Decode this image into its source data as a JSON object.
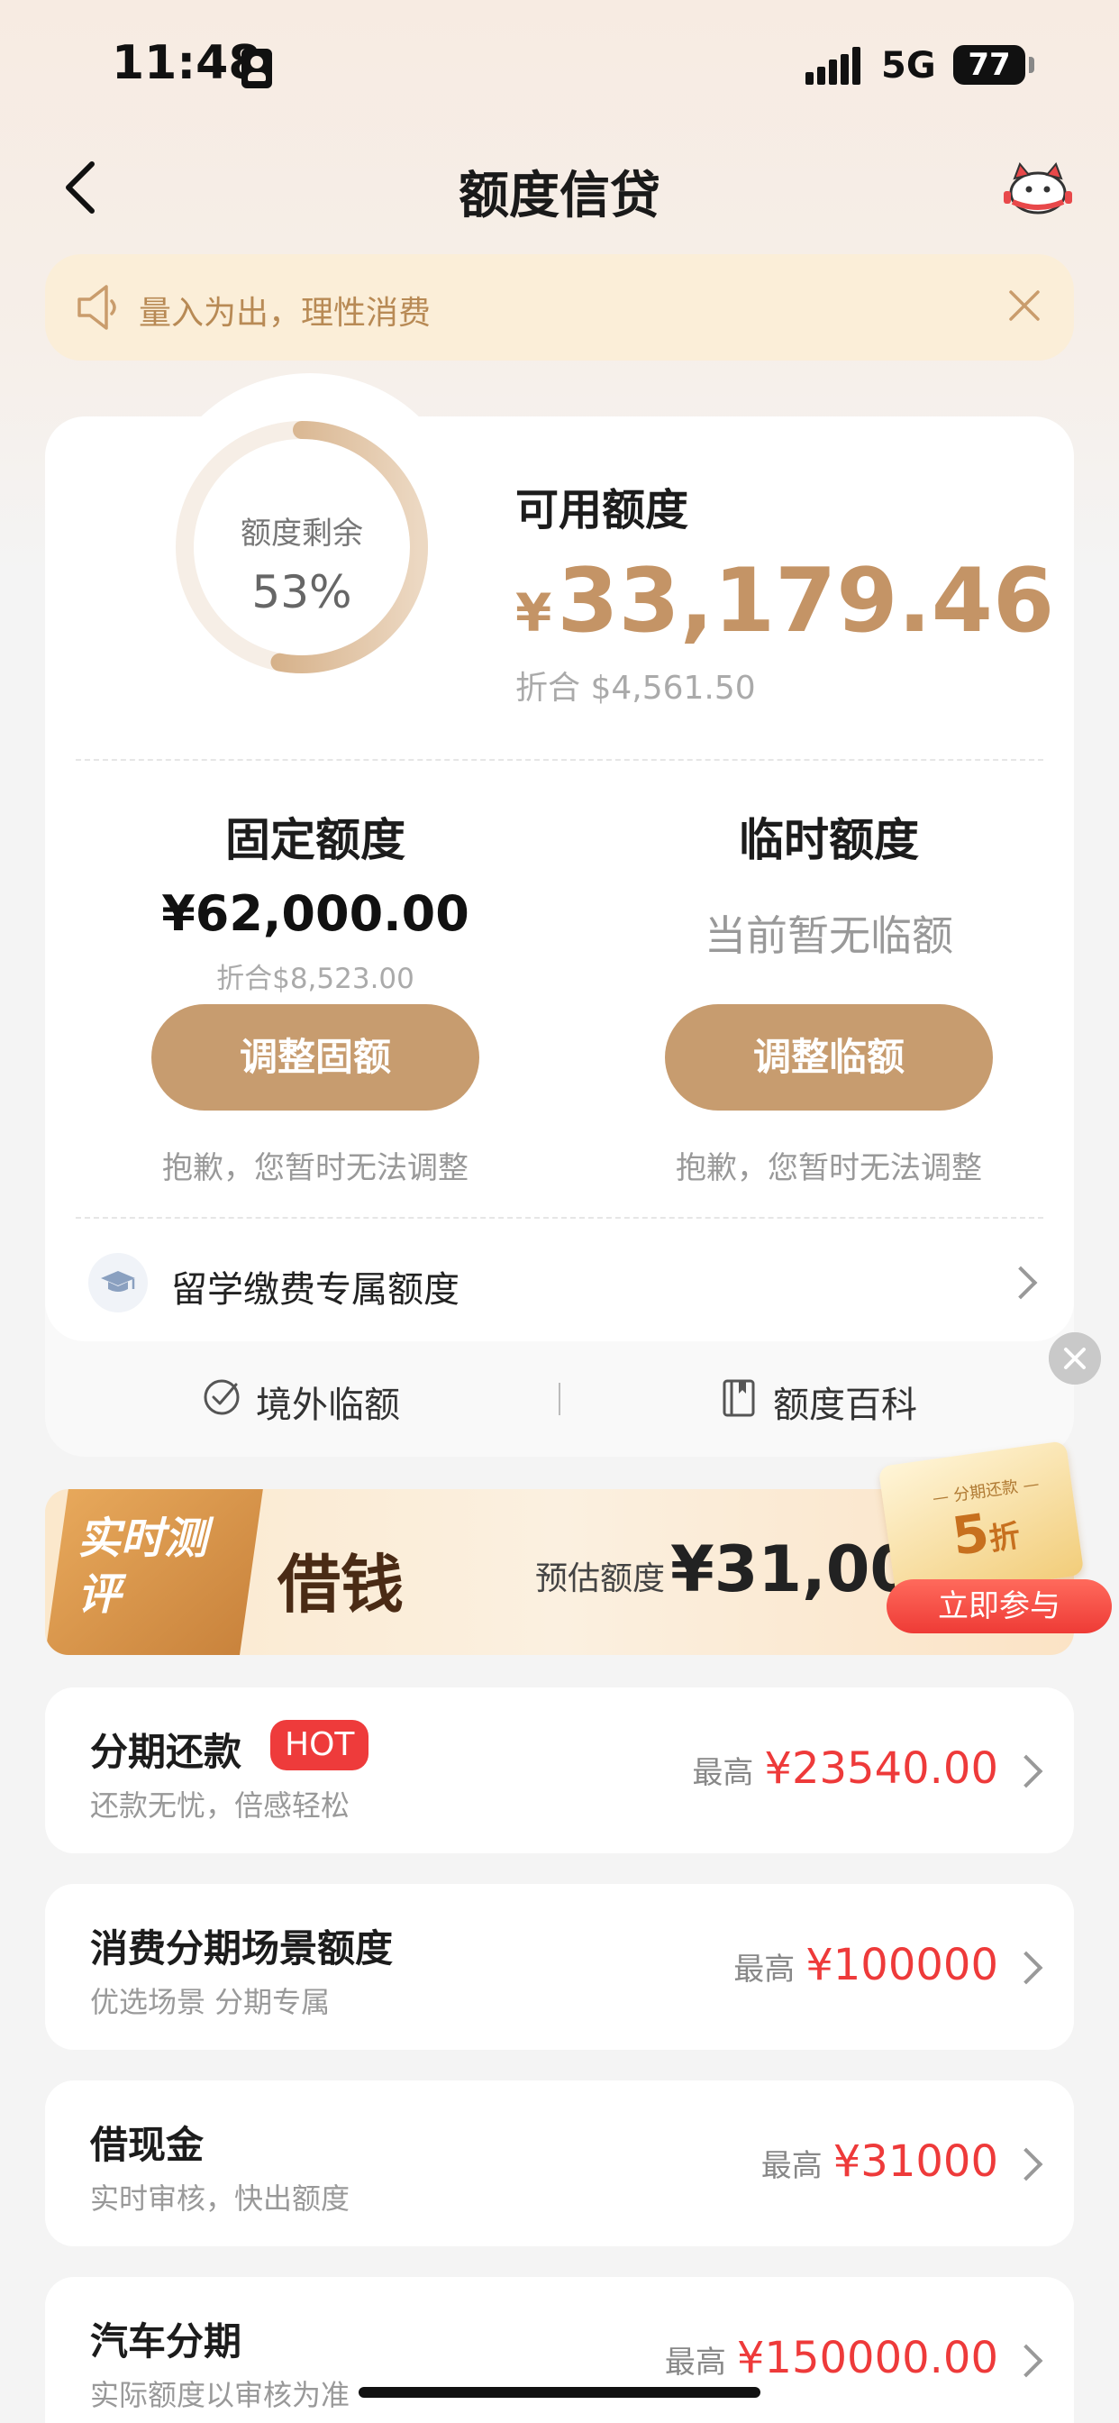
{
  "status_bar": {
    "time": "11:48",
    "network": "5G",
    "battery": "77"
  },
  "nav": {
    "title": "额度信贷"
  },
  "notice": {
    "text": "量入为出，理性消费"
  },
  "credit": {
    "ring_label": "额度剩余",
    "ring_value": "53%",
    "ring_fraction": 0.53,
    "available_label": "可用额度",
    "available_currency": "¥",
    "available_amount": "33,179.46",
    "available_equiv": "折合 $4,561.50",
    "fixed": {
      "title": "固定额度",
      "amount": "¥62,000.00",
      "equiv": "折合$8,523.00",
      "button": "调整固额",
      "note": "抱歉，您暂时无法调整"
    },
    "temporary": {
      "title": "临时额度",
      "status": "当前暂无临额",
      "button": "调整临额",
      "note": "抱歉，您暂时无法调整"
    },
    "study_abroad": "留学缴费专属额度",
    "quick_links": [
      {
        "label": "境外临额",
        "icon": "compass-check-icon"
      },
      {
        "label": "额度百科",
        "icon": "book-icon"
      }
    ]
  },
  "banner": {
    "tag": "实时测评",
    "title": "借钱",
    "estimate_label": "预估额度",
    "estimate_value": "¥31,000",
    "coupon_sub": "— 分期还款 —",
    "coupon_value": "5",
    "coupon_unit": "折",
    "join_button": "立即参与"
  },
  "products": [
    {
      "title": "分期还款",
      "badge": "HOT",
      "subtitle": "还款无忧，倍感轻松",
      "max_label": "最高",
      "max_value": "¥23540.00"
    },
    {
      "title": "消费分期场景额度",
      "subtitle": "优选场景 分期专属",
      "max_label": "最高",
      "max_value": "¥100000"
    },
    {
      "title": "借现金",
      "subtitle": "实时审核，快出额度",
      "max_label": "最高",
      "max_value": "¥31000"
    },
    {
      "title": "汽车分期",
      "subtitle": "实际额度以审核为准",
      "max_label": "最高",
      "max_value": "¥150000.00"
    }
  ],
  "colors": {
    "accent": "#c79c6f",
    "price_red": "#ee3a3a",
    "notice_bg": "#fbeed8"
  }
}
